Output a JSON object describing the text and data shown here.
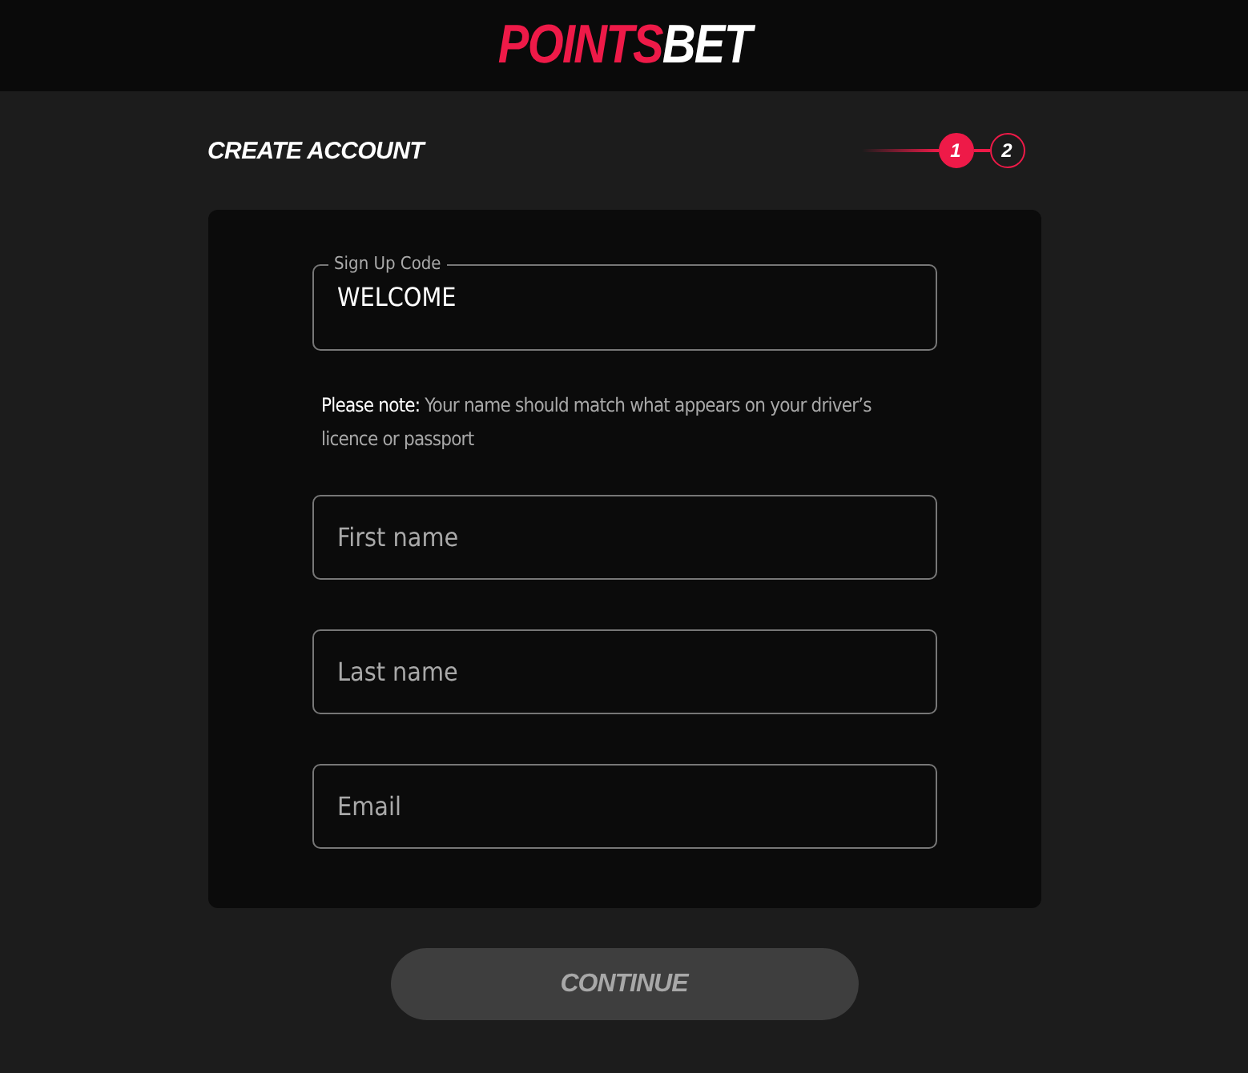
{
  "logo": {
    "part_1": "POINTS",
    "part_2": "BET"
  },
  "title": "CREATE ACCOUNT",
  "steps": [
    {
      "label": "1",
      "selected": true
    },
    {
      "label": "2",
      "selected": false
    }
  ],
  "signup_code": {
    "label": "Sign Up Code",
    "value": "WELCOME"
  },
  "note": "**Please note:** Your name should match what appears on your driver’s licence or passport",
  "fields": [
    {
      "placeholder": "First name"
    },
    {
      "placeholder": "Last name"
    },
    {
      "placeholder": "Email"
    }
  ],
  "continue_button": {
    "label": "CONTINUE",
    "disabled": true
  }
}
